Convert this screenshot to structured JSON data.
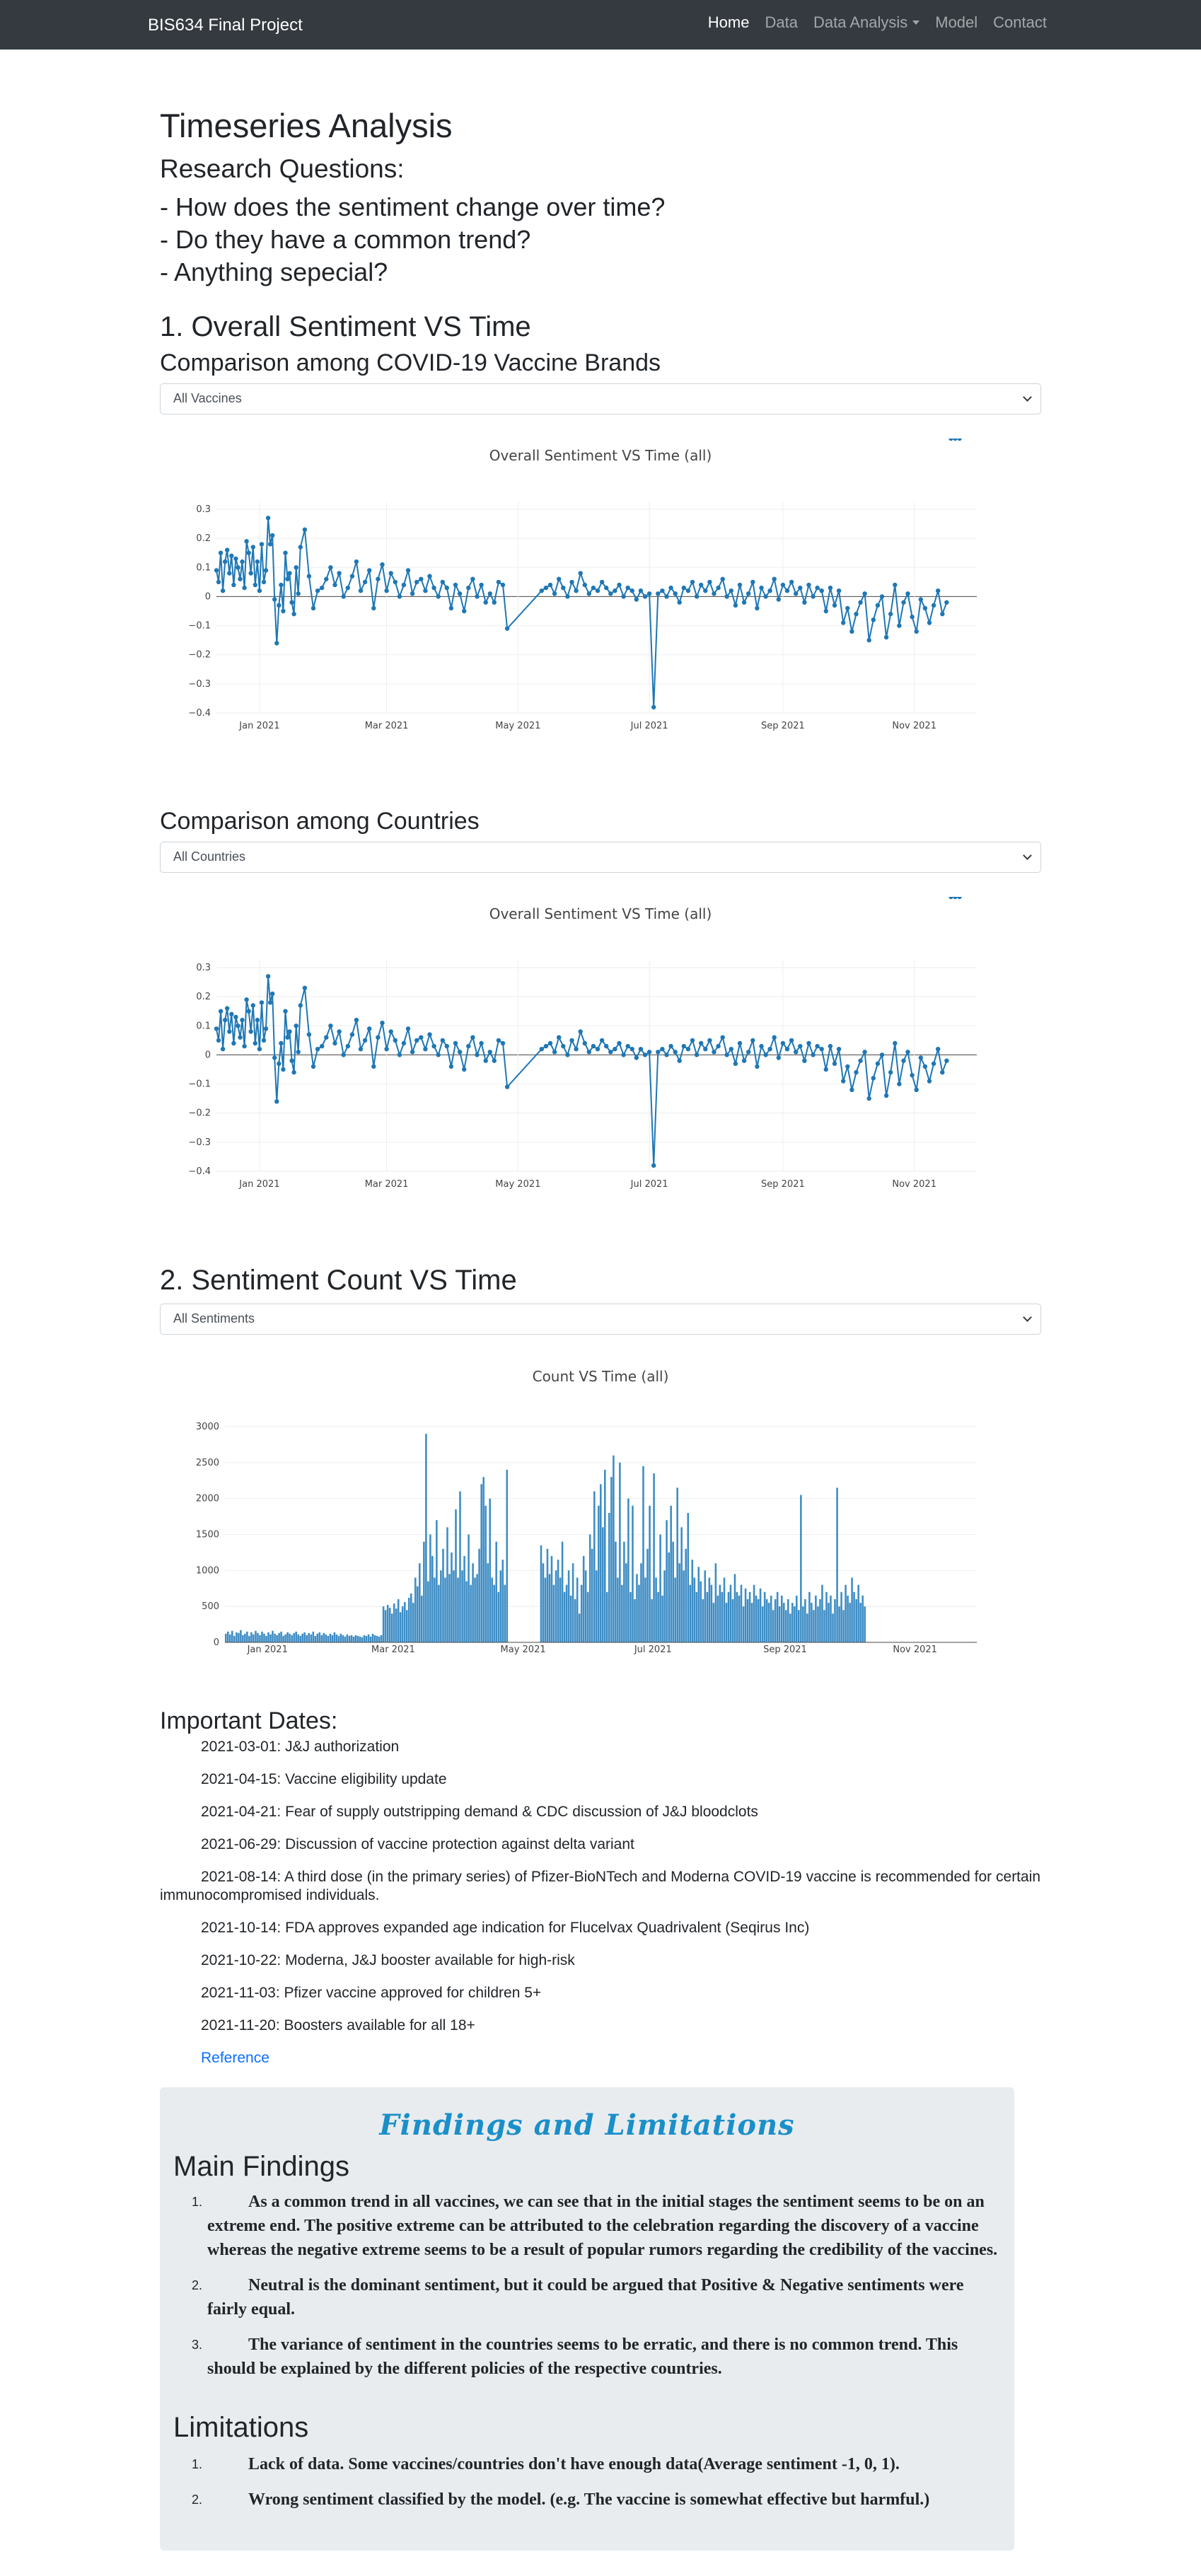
{
  "navbar": {
    "brand": "BIS634 Final Project",
    "links": [
      "Home",
      "Data",
      "Data Analysis",
      "Model",
      "Contact"
    ]
  },
  "page": {
    "title": "Timeseries Analysis",
    "rq_heading": "Research Questions:",
    "questions": [
      "- How does the sentiment change over time?",
      "- Do they have a common trend?",
      "- Anything sepecial?"
    ]
  },
  "section1": {
    "heading": "1. Overall Sentiment VS Time",
    "brands_heading": "Comparison among COVID-19 Vaccine Brands",
    "brands_select": "All Vaccines",
    "countries_heading": "Comparison among Countries",
    "countries_select": "All Countries"
  },
  "section2": {
    "heading": "2. Sentiment Count VS Time",
    "select": "All Sentiments"
  },
  "important_dates": {
    "heading": "Important Dates:",
    "items": [
      "2021-03-01: J&J authorization",
      "2021-04-15: Vaccine eligibility update",
      "2021-04-21: Fear of supply outstripping demand & CDC discussion of J&J bloodclots",
      "2021-06-29: Discussion of vaccine protection against delta variant",
      "2021-08-14: A third dose (in the primary series) of Pfizer-BioNTech and Moderna COVID-19 vaccine is recommended for certain immunocompromised individuals.",
      "2021-10-14: FDA approves expanded age indication for Flucelvax Quadrivalent (Seqirus Inc)",
      "2021-10-22: Moderna, J&J booster available for high-risk",
      "2021-11-03: Pfizer vaccine approved for children 5+",
      "2021-11-20: Boosters available for all 18+"
    ],
    "reference": "Reference"
  },
  "findings": {
    "title": "Findings and Limitations",
    "main_heading": "Main Findings",
    "main_items": [
      "As a common trend in all vaccines, we can see that in the initial stages the sentiment seems to be on an extreme end. The positive extreme can be attributed to the celebration regarding the discovery of a vaccine whereas the negative extreme seems to be a result of popular rumors regarding the credibility of the vaccines.",
      "Neutral is the dominant sentiment, but it could be argued that Positive & Negative sentiments were fairly equal.",
      "The variance of sentiment in the countries seems to be erratic, and there is no common trend. This should be explained by the different policies of the respective countries."
    ],
    "lim_heading": "Limitations",
    "lim_items": [
      "Lack of data. Some vaccines/countries don't have enough data(Average sentiment -1, 0, 1).",
      "Wrong sentiment classified by the model. (e.g. The vaccine is somewhat effective but harmful.)"
    ]
  },
  "colors": {
    "line": "#1f77b4",
    "bar": "#3d8cc4",
    "title": "#1a8fc9"
  },
  "chart_data": [
    {
      "type": "line",
      "title": "Overall Sentiment VS Time (all)",
      "x_ticks": [
        "Jan 2021",
        "Mar 2021",
        "May 2021",
        "Jul 2021",
        "Sep 2021",
        "Nov 2021"
      ],
      "y_ticks": [
        "0.3",
        "0.2",
        "0.1",
        "0",
        "−0.1",
        "−0.2",
        "−0.3",
        "−0.4"
      ],
      "xlim": [
        "2020-12-12",
        "2021-11-30"
      ],
      "ylim": [
        -0.4,
        0.3
      ],
      "x": [
        "2020-12-12",
        "2020-12-13",
        "2020-12-14",
        "2020-12-15",
        "2020-12-16",
        "2020-12-17",
        "2020-12-18",
        "2020-12-19",
        "2020-12-20",
        "2020-12-21",
        "2020-12-22",
        "2020-12-23",
        "2020-12-24",
        "2020-12-25",
        "2020-12-26",
        "2020-12-27",
        "2020-12-28",
        "2020-12-29",
        "2020-12-30",
        "2020-12-31",
        "2021-01-01",
        "2021-01-02",
        "2021-01-03",
        "2021-01-04",
        "2021-01-05",
        "2021-01-06",
        "2021-01-07",
        "2021-01-08",
        "2021-01-09",
        "2021-01-10",
        "2021-01-11",
        "2021-01-12",
        "2021-01-13",
        "2021-01-14",
        "2021-01-15",
        "2021-01-16",
        "2021-01-17",
        "2021-01-18",
        "2021-01-19",
        "2021-01-20",
        "2021-01-22",
        "2021-01-24",
        "2021-01-26",
        "2021-01-28",
        "2021-01-30",
        "2021-02-01",
        "2021-02-03",
        "2021-02-05",
        "2021-02-07",
        "2021-02-09",
        "2021-02-11",
        "2021-02-13",
        "2021-02-15",
        "2021-02-17",
        "2021-02-19",
        "2021-02-21",
        "2021-02-23",
        "2021-02-25",
        "2021-02-27",
        "2021-03-01",
        "2021-03-03",
        "2021-03-05",
        "2021-03-07",
        "2021-03-09",
        "2021-03-11",
        "2021-03-13",
        "2021-03-15",
        "2021-03-17",
        "2021-03-19",
        "2021-03-21",
        "2021-03-23",
        "2021-03-25",
        "2021-03-27",
        "2021-03-29",
        "2021-03-31",
        "2021-04-02",
        "2021-04-04",
        "2021-04-06",
        "2021-04-08",
        "2021-04-10",
        "2021-04-12",
        "2021-04-14",
        "2021-04-16",
        "2021-04-18",
        "2021-04-20",
        "2021-04-22",
        "2021-04-24",
        "2021-04-26",
        "2021-05-12",
        "2021-05-14",
        "2021-05-16",
        "2021-05-18",
        "2021-05-20",
        "2021-05-22",
        "2021-05-24",
        "2021-05-26",
        "2021-05-28",
        "2021-05-30",
        "2021-06-01",
        "2021-06-03",
        "2021-06-05",
        "2021-06-07",
        "2021-06-09",
        "2021-06-11",
        "2021-06-13",
        "2021-06-15",
        "2021-06-17",
        "2021-06-19",
        "2021-06-21",
        "2021-06-23",
        "2021-06-25",
        "2021-06-27",
        "2021-06-29",
        "2021-07-01",
        "2021-07-03",
        "2021-07-05",
        "2021-07-07",
        "2021-07-09",
        "2021-07-11",
        "2021-07-13",
        "2021-07-15",
        "2021-07-17",
        "2021-07-19",
        "2021-07-21",
        "2021-07-23",
        "2021-07-25",
        "2021-07-27",
        "2021-07-29",
        "2021-07-31",
        "2021-08-02",
        "2021-08-04",
        "2021-08-06",
        "2021-08-08",
        "2021-08-10",
        "2021-08-12",
        "2021-08-14",
        "2021-08-16",
        "2021-08-18",
        "2021-08-20",
        "2021-08-22",
        "2021-08-24",
        "2021-08-26",
        "2021-08-28",
        "2021-08-30",
        "2021-09-01",
        "2021-09-03",
        "2021-09-05",
        "2021-09-07",
        "2021-09-09",
        "2021-09-11",
        "2021-09-13",
        "2021-09-15",
        "2021-09-17",
        "2021-09-19",
        "2021-09-21",
        "2021-09-23",
        "2021-09-25",
        "2021-09-27",
        "2021-09-29",
        "2021-10-01",
        "2021-10-03",
        "2021-10-05",
        "2021-10-07",
        "2021-10-09",
        "2021-10-11",
        "2021-10-13",
        "2021-10-15",
        "2021-10-17",
        "2021-10-19",
        "2021-10-21",
        "2021-10-23",
        "2021-10-25",
        "2021-10-27",
        "2021-10-29",
        "2021-10-31",
        "2021-11-02",
        "2021-11-04",
        "2021-11-06",
        "2021-11-08",
        "2021-11-10",
        "2021-11-12",
        "2021-11-14",
        "2021-11-16",
        "2021-11-18",
        "2021-11-20",
        "2021-11-22"
      ],
      "y": [
        0.09,
        0.05,
        0.15,
        0.02,
        0.12,
        0.16,
        0.08,
        0.14,
        0.04,
        0.13,
        0.1,
        0.06,
        0.12,
        0.03,
        0.19,
        0.15,
        0.08,
        0.17,
        0.04,
        0.12,
        0.02,
        0.18,
        0.05,
        0.09,
        0.27,
        0.18,
        0.21,
        -0.01,
        -0.16,
        -0.03,
        0.04,
        -0.05,
        0.15,
        0.06,
        0.08,
        -0.02,
        -0.06,
        0.1,
        0.01,
        0.17,
        0.23,
        0.07,
        -0.04,
        0.02,
        0.03,
        0.06,
        0.1,
        0.04,
        0.08,
        0.0,
        0.03,
        0.07,
        0.12,
        0.02,
        0.05,
        0.09,
        -0.04,
        0.06,
        0.11,
        0.02,
        0.08,
        0.05,
        0.0,
        0.04,
        0.09,
        0.01,
        0.05,
        0.06,
        0.02,
        0.07,
        0.03,
        0.0,
        0.05,
        0.03,
        -0.04,
        0.04,
        0.01,
        -0.05,
        0.03,
        0.06,
        0.0,
        0.04,
        -0.02,
        0.01,
        -0.02,
        0.05,
        0.04,
        -0.11,
        0.02,
        0.03,
        0.04,
        0.01,
        0.06,
        0.03,
        0.0,
        0.05,
        0.02,
        0.08,
        0.04,
        0.01,
        0.03,
        0.02,
        0.05,
        0.03,
        0.01,
        0.02,
        0.04,
        0.0,
        0.03,
        0.02,
        -0.01,
        0.02,
        0.0,
        0.01,
        -0.38,
        0.01,
        0.02,
        0.0,
        0.03,
        0.01,
        -0.02,
        0.03,
        0.02,
        0.05,
        0.0,
        0.04,
        0.02,
        0.05,
        0.01,
        0.03,
        0.06,
        0.0,
        0.02,
        -0.03,
        0.04,
        -0.02,
        0.01,
        0.05,
        -0.04,
        0.03,
        0.0,
        0.02,
        0.06,
        -0.01,
        0.04,
        0.02,
        0.05,
        0.01,
        0.03,
        -0.02,
        0.04,
        0.0,
        0.03,
        0.02,
        -0.05,
        0.03,
        -0.03,
        0.02,
        -0.09,
        -0.04,
        -0.12,
        -0.06,
        -0.02,
        0.01,
        -0.15,
        -0.08,
        -0.03,
        0.0,
        -0.14,
        -0.06,
        0.04,
        -0.1,
        -0.02,
        0.01,
        -0.07,
        -0.12,
        -0.01,
        -0.04,
        -0.09,
        -0.03,
        0.02,
        -0.06,
        -0.02
      ]
    },
    {
      "type": "line",
      "title": "Overall Sentiment VS Time (all)",
      "x_ticks": [
        "Jan 2021",
        "Mar 2021",
        "May 2021",
        "Jul 2021",
        "Sep 2021",
        "Nov 2021"
      ],
      "y_ticks": [
        "0.3",
        "0.2",
        "0.1",
        "0",
        "−0.1",
        "−0.2",
        "−0.3",
        "−0.4"
      ],
      "xlim": [
        "2020-12-12",
        "2021-11-30"
      ],
      "ylim": [
        -0.4,
        0.3
      ],
      "same_as_previous": true
    },
    {
      "type": "bar",
      "title": "Count VS Time (all)",
      "x_ticks": [
        "Jan 2021",
        "Mar 2021",
        "May 2021",
        "Jul 2021",
        "Sep 2021",
        "Nov 2021"
      ],
      "y_ticks": [
        "3000",
        "2500",
        "2000",
        "1500",
        "1000",
        "500",
        "0"
      ],
      "xlim": [
        "2020-12-12",
        "2021-11-30"
      ],
      "ylim": [
        0,
        3000
      ],
      "x_start": "2020-12-12",
      "values": [
        120,
        150,
        110,
        160,
        90,
        140,
        130,
        170,
        100,
        120,
        150,
        90,
        140,
        110,
        160,
        130,
        100,
        150,
        120,
        90,
        140,
        110,
        160,
        120,
        100,
        130,
        150,
        90,
        110,
        140,
        120,
        100,
        130,
        150,
        110,
        90,
        120,
        140,
        100,
        130,
        110,
        150,
        90,
        120,
        140,
        100,
        130,
        110,
        90,
        120,
        100,
        140,
        110,
        90,
        120,
        100,
        80,
        110,
        90,
        100,
        80,
        100,
        90,
        80,
        70,
        100,
        90,
        110,
        80,
        120,
        100,
        90,
        80,
        100,
        500,
        450,
        520,
        480,
        400,
        540,
        470,
        600,
        420,
        500,
        560,
        450,
        620,
        680,
        550,
        900,
        780,
        1100,
        650,
        1400,
        2900,
        850,
        1500,
        1200,
        900,
        1700,
        800,
        1000,
        1300,
        900,
        1600,
        950,
        1250,
        1000,
        1850,
        900,
        2100,
        1000,
        1200,
        850,
        1500,
        800,
        1100,
        900,
        950,
        1300,
        2200,
        2300,
        1900,
        1100,
        2000,
        900,
        800,
        1400,
        700,
        1000,
        1150,
        800,
        2400,
        0,
        0,
        0,
        0,
        0,
        0,
        0,
        0,
        0,
        0,
        0,
        0,
        0,
        0,
        0,
        1350,
        1100,
        900,
        1300,
        950,
        1200,
        800,
        1000,
        1150,
        900,
        1400,
        700,
        800,
        1000,
        650,
        1100,
        600,
        900,
        400,
        800,
        1200,
        1000,
        700,
        1500,
        1300,
        2100,
        1000,
        1900,
        2200,
        1600,
        2400,
        700,
        1800,
        2300,
        2600,
        1400,
        900,
        2500,
        800,
        1400,
        1100,
        2000,
        700,
        1900,
        600,
        950,
        800,
        1100,
        2450,
        900,
        1300,
        1900,
        600,
        2350,
        900,
        700,
        1500,
        650,
        1000,
        1700,
        1250,
        1900,
        1400,
        900,
        2150,
        1100,
        1600,
        1000,
        1300,
        1800,
        800,
        1150,
        900,
        700,
        1050,
        850,
        600,
        1000,
        700,
        900,
        800,
        550,
        1100,
        650,
        800,
        700,
        900,
        550,
        700,
        800,
        600,
        950,
        700,
        650,
        800,
        500,
        750,
        600,
        700,
        550,
        800,
        650,
        600,
        750,
        500,
        700,
        600,
        550,
        650,
        450,
        600,
        700,
        500,
        650,
        550,
        450,
        600,
        400,
        550,
        500,
        650,
        450,
        2050,
        500,
        600,
        400,
        700,
        550,
        450,
        650,
        500,
        600,
        800,
        450,
        700,
        550,
        650,
        400,
        600,
        2150,
        500,
        700,
        450,
        800,
        650,
        550,
        900,
        700,
        600,
        800,
        550,
        650,
        500
      ]
    }
  ]
}
